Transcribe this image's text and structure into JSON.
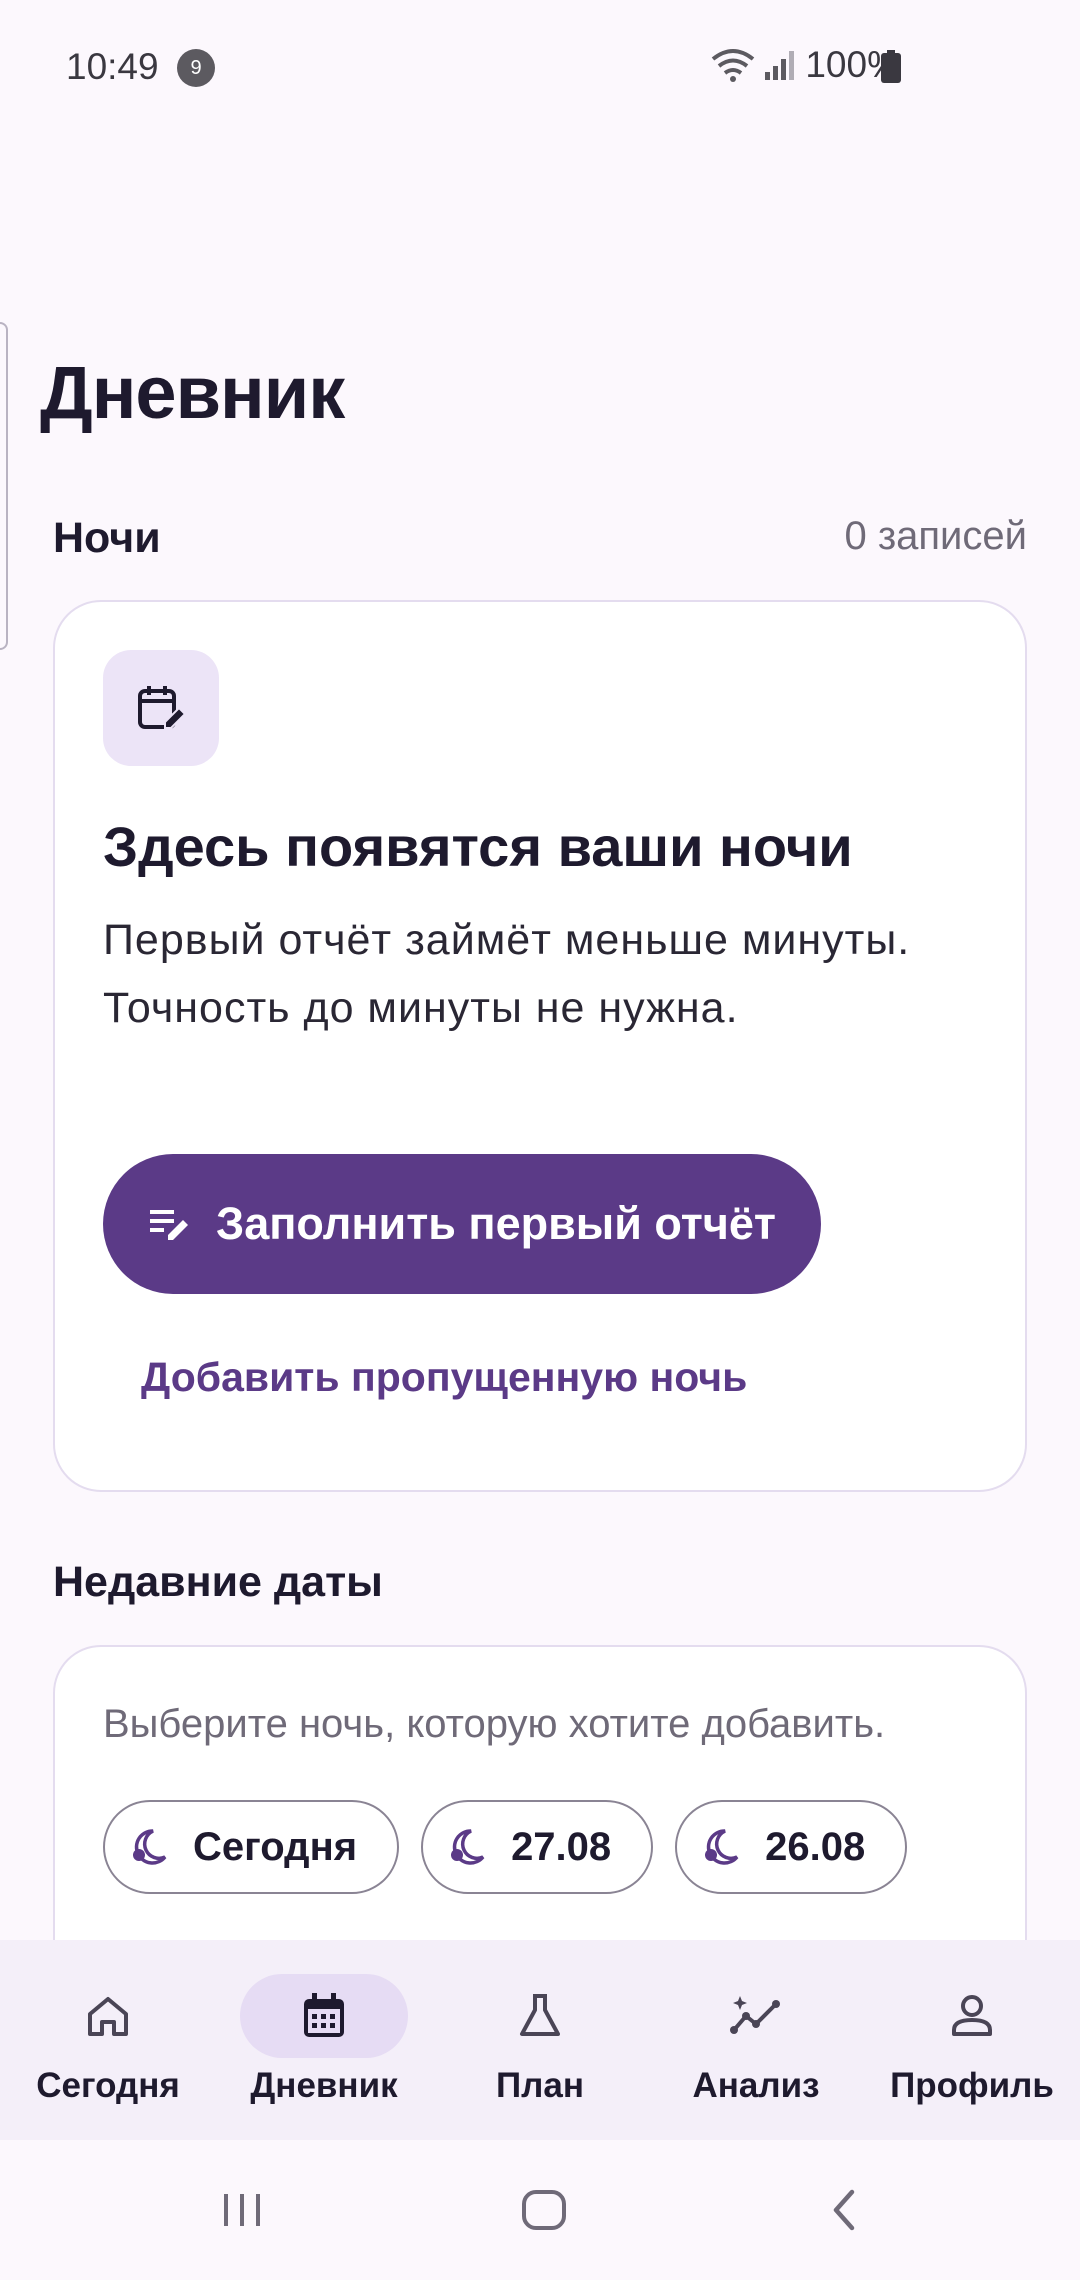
{
  "status_bar": {
    "time": "10:49",
    "notification_count": "9",
    "battery": "100%"
  },
  "page": {
    "title": "Дневник"
  },
  "nights": {
    "section_title": "Ночи",
    "records_count": "0 записей",
    "empty_title": "Здесь появятся ваши ночи",
    "empty_description": "Первый отчёт займёт меньше минуты. Точность до минуты не нужна.",
    "primary_button": "Заполнить первый отчёт",
    "secondary_button": "Добавить пропущенную ночь",
    "icon": "calendar-edit-icon"
  },
  "recent_dates": {
    "section_title": "Недавние даты",
    "hint": "Выберите ночь, которую хотите добавить.",
    "chips": [
      {
        "label": "Сегодня",
        "icon": "moon-icon"
      },
      {
        "label": "27.08",
        "icon": "moon-icon"
      },
      {
        "label": "26.08",
        "icon": "moon-icon"
      }
    ]
  },
  "bottom_nav": {
    "items": [
      {
        "label": "Сегодня",
        "icon": "home-icon",
        "active": false
      },
      {
        "label": "Дневник",
        "icon": "calendar-icon",
        "active": true
      },
      {
        "label": "План",
        "icon": "flask-icon",
        "active": false
      },
      {
        "label": "Анализ",
        "icon": "analytics-icon",
        "active": false
      },
      {
        "label": "Профиль",
        "icon": "person-icon",
        "active": false
      }
    ]
  },
  "colors": {
    "accent": "#5b3a87",
    "background": "#fcf8fd",
    "nav_background": "#f4eff9",
    "active_pill": "#e6dcf4"
  }
}
